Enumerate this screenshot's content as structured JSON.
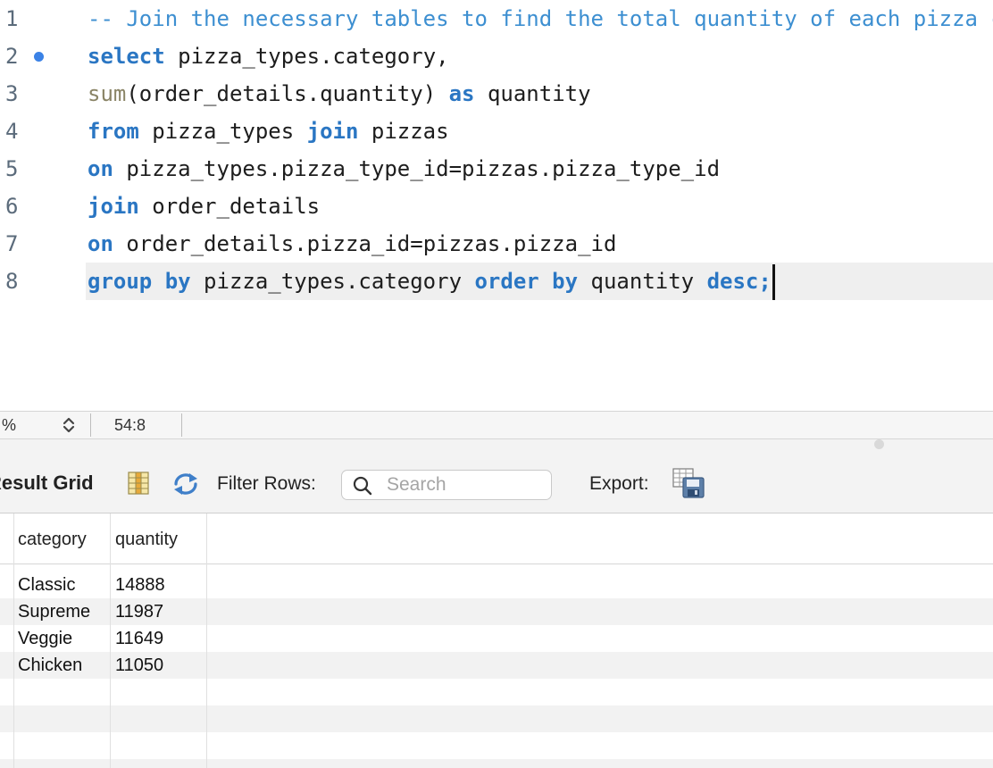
{
  "editor": {
    "lines": [
      {
        "number": "1",
        "segments": [
          {
            "text": "-- Join the necessary tables to find the total quantity of each pizza category ordered.",
            "class": "cm"
          }
        ]
      },
      {
        "number": "2",
        "marker": true,
        "segments": [
          {
            "text": "select",
            "class": "kw"
          },
          {
            "text": " pizza_types.category,",
            "class": ""
          }
        ]
      },
      {
        "number": "3",
        "segments": [
          {
            "text": "sum",
            "class": "fn"
          },
          {
            "text": "(order_details.quantity) ",
            "class": ""
          },
          {
            "text": "as",
            "class": "kw"
          },
          {
            "text": " quantity",
            "class": ""
          }
        ]
      },
      {
        "number": "4",
        "segments": [
          {
            "text": "from",
            "class": "kw"
          },
          {
            "text": " pizza_types ",
            "class": ""
          },
          {
            "text": "join",
            "class": "kw"
          },
          {
            "text": " pizzas",
            "class": ""
          }
        ]
      },
      {
        "number": "5",
        "segments": [
          {
            "text": "on",
            "class": "kw"
          },
          {
            "text": " pizza_types.pizza_type_id=pizzas.pizza_type_id",
            "class": ""
          }
        ]
      },
      {
        "number": "6",
        "segments": [
          {
            "text": "join",
            "class": "kw"
          },
          {
            "text": " order_details",
            "class": ""
          }
        ]
      },
      {
        "number": "7",
        "segments": [
          {
            "text": "on",
            "class": "kw"
          },
          {
            "text": " order_details.pizza_id=pizzas.pizza_id",
            "class": ""
          }
        ]
      },
      {
        "number": "8",
        "current": true,
        "segments": [
          {
            "text": "group by",
            "class": "kw"
          },
          {
            "text": " pizza_types.category ",
            "class": ""
          },
          {
            "text": "order by",
            "class": "kw"
          },
          {
            "text": " quantity ",
            "class": ""
          },
          {
            "text": "desc;",
            "class": "kw"
          }
        ]
      }
    ]
  },
  "statusbar": {
    "zoom": "%",
    "cursor_position": "54:8"
  },
  "result_toolbar": {
    "title": "Result Grid",
    "filter_label": "Filter Rows:",
    "search_placeholder": "Search",
    "export_label": "Export:"
  },
  "icons": {
    "grid": "result-grid-icon",
    "refresh": "refresh-icon",
    "search": "search-icon",
    "export": "export-icon",
    "stepper": "chevron-updown-icon"
  },
  "grid": {
    "columns": [
      "category",
      "quantity"
    ],
    "rows": [
      [
        "Classic",
        "14888"
      ],
      [
        "Supreme",
        "11987"
      ],
      [
        "Veggie",
        "11649"
      ],
      [
        "Chicken",
        "11050"
      ]
    ]
  },
  "colors": {
    "comment": "#3d8fd1",
    "keyword": "#2a76c3",
    "function": "#8a8466",
    "marker": "#3b82e6"
  }
}
